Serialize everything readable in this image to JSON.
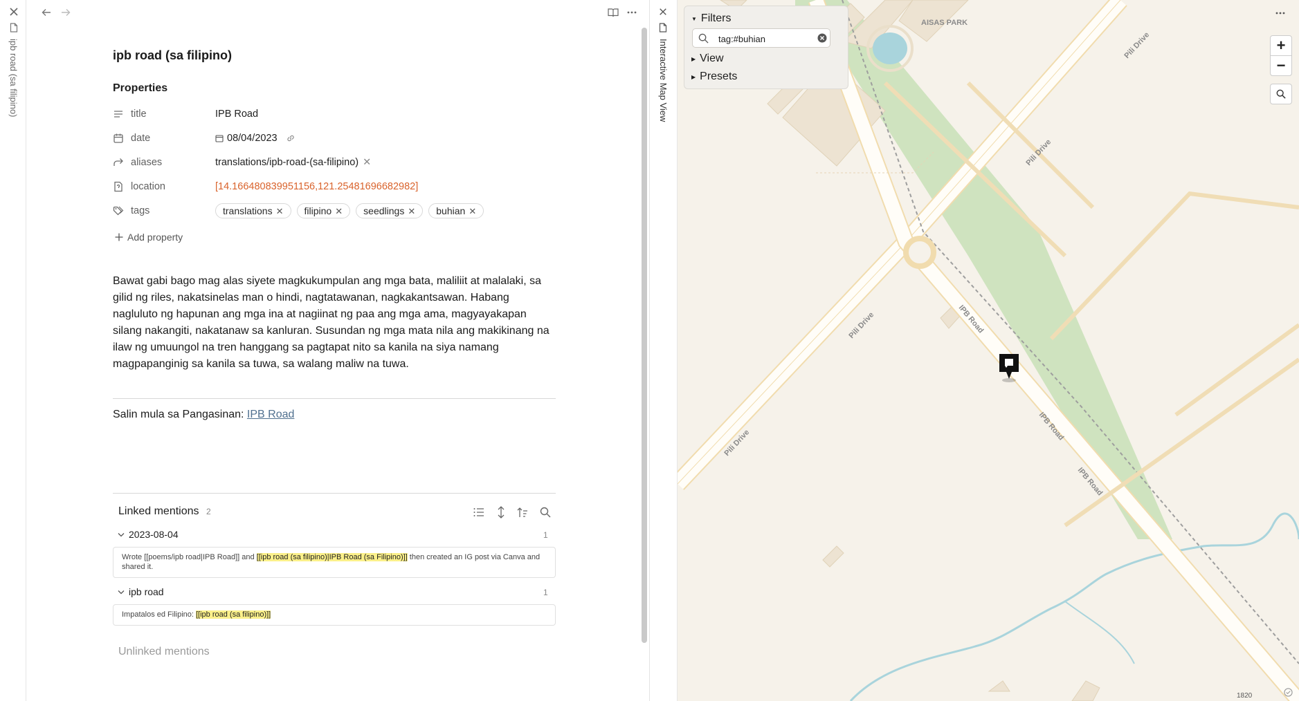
{
  "left_strip": {
    "vertical_title": "ipb road (sa filipino)"
  },
  "note": {
    "title": "ipb road (sa filipino)",
    "properties_heading": "Properties",
    "properties": [
      {
        "key": "title",
        "value": "IPB Road",
        "icon": "text-lines-icon"
      },
      {
        "key": "date",
        "value": "08/04/2023",
        "icon": "calendar-icon"
      },
      {
        "key": "aliases",
        "value": "translations/ipb-road-(sa-filipino)",
        "icon": "forward-arrow-icon"
      },
      {
        "key": "location",
        "value": "[14.166480839951156,121.25481696682982]",
        "icon": "file-question-icon"
      },
      {
        "key": "tags",
        "icon": "tags-icon"
      }
    ],
    "tags": [
      "translations",
      "filipino",
      "seedlings",
      "buhian"
    ],
    "add_property": "Add property",
    "body": "Bawat gabi bago mag alas siyete magkukumpulan ang mga bata, maliliit at malalaki, sa gilid ng riles, nakatsinelas man o hindi, nagtatawanan, nagkakantsawan. Habang nagluluto ng hapunan ang mga ina at nagiinat ng paa ang mga ama, magyayakapan silang nakangiti, nakatanaw sa kanluran. Susundan ng mga mata nila ang makikinang na ilaw ng umuungol na tren hanggang sa pagtapat nito sa kanila na siya namang magpapanginig sa kanila sa tuwa, sa walang maliw na tuwa.",
    "source_prefix": "Salin mula sa Pangasinan: ",
    "source_link": "IPB Road",
    "linked_mentions": {
      "label": "Linked mentions",
      "count": "2",
      "groups": [
        {
          "name": "2023-08-04",
          "count": "1",
          "pre": "Wrote [[poems/ipb road|IPB Road]] and ",
          "highlight": "[[ipb road (sa filipino)|IPB Road (sa Filipino)]]",
          "post": " then created an IG post via Canva and shared it."
        },
        {
          "name": "ipb road",
          "count": "1",
          "pre": "Impatalos ed Filipino: ",
          "highlight": "[[ipb road (sa filipino)]]",
          "post": ""
        }
      ]
    },
    "unlinked_mentions": "Unlinked mentions"
  },
  "right_strip": {
    "vertical_title": "Interactive Map View"
  },
  "map": {
    "filters_label": "Filters",
    "search_value": "tag:#buhian",
    "view_label": "View",
    "presets_label": "Presets",
    "zoom_in": "+",
    "zoom_out": "−",
    "scale_label": "1820",
    "labels": {
      "park": "AISAS PARK",
      "pili1": "Pili Drive",
      "pili2": "Pili Drive",
      "pili3": "Pili Drive",
      "pili4": "Pili Drive",
      "ipb1": "IPB Road",
      "ipb2": "IPB Road",
      "ipb3": "IPB Road"
    },
    "colors": {
      "land": "#f6f2ea",
      "green": "#cfe3bf",
      "water": "#a9d4dc",
      "building": "#ede3d2",
      "road_edge": "#f1dcae"
    }
  }
}
